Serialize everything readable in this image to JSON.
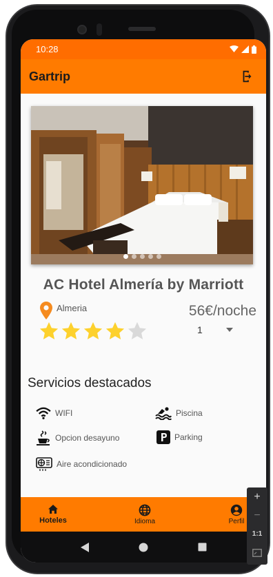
{
  "status_bar": {
    "time": "10:28"
  },
  "app_bar": {
    "title": "Gartrip",
    "logout_icon": "logout-icon"
  },
  "hotel": {
    "name": "AC Hotel Almería by Marriott",
    "location": "Almeria",
    "price": "56€/noche",
    "rating": 4,
    "max_rating": 5,
    "quantity": "1",
    "carousel": {
      "slides": 5,
      "active": 0
    }
  },
  "services": {
    "title": "Servicios destacados",
    "items": [
      {
        "label": "WIFI",
        "icon": "wifi-icon"
      },
      {
        "label": "Piscina",
        "icon": "pool-icon"
      },
      {
        "label": "Opcion desayuno",
        "icon": "breakfast-icon"
      },
      {
        "label": "Parking",
        "icon": "parking-icon"
      },
      {
        "label": "Aire acondicionado",
        "icon": "air-conditioner-icon"
      }
    ]
  },
  "bottom_nav": {
    "items": [
      {
        "label": "Hoteles",
        "icon": "home-icon",
        "active": true
      },
      {
        "label": "Idioma",
        "icon": "globe-icon",
        "active": false
      },
      {
        "label": "Perfil",
        "icon": "account-icon",
        "active": false
      }
    ]
  },
  "emulator_zoom": {
    "plus": "+",
    "minus": "−",
    "one_to_one": "1:1"
  },
  "colors": {
    "primary": "#ff7b00",
    "status_bar": "#ff6d00",
    "star": "#fdd12d",
    "star_empty": "#d9d9d9",
    "pin": "#f58b1f"
  }
}
